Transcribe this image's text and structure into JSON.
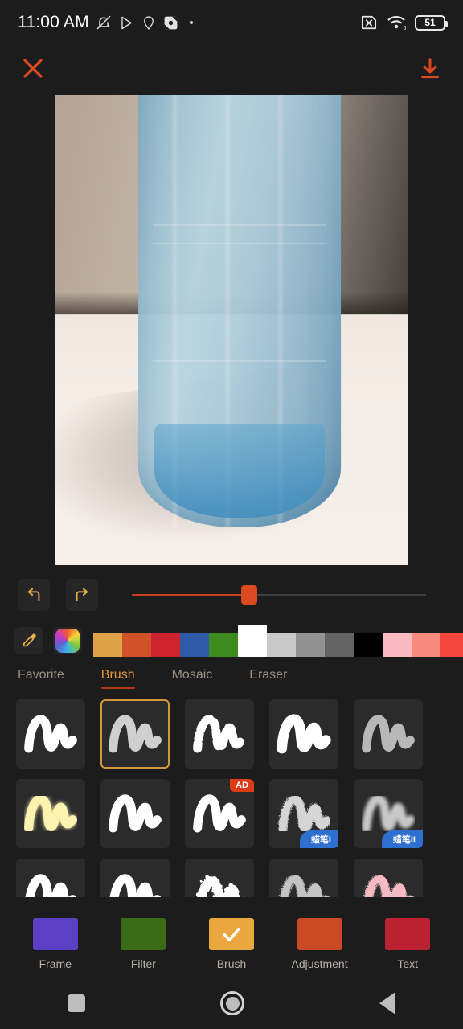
{
  "status_bar": {
    "time": "11:00 AM",
    "battery_level": "51",
    "wifi_generation": "6",
    "left_icons": [
      "silent-mode-icon",
      "play-store-icon",
      "location-pin-icon",
      "google-maps-icon",
      "more-dot-icon"
    ],
    "right_icons": [
      "sim-off-icon",
      "wifi-icon",
      "battery-icon"
    ]
  },
  "top_bar": {
    "close_label": "close-icon",
    "save_label": "download-icon",
    "accent_color": "#dc4a22"
  },
  "photo": {
    "subject": "blue plastic bottle on white table",
    "alt": "Close-up photo of a translucent blue plastic bottle standing on a white table with a beige wall behind it"
  },
  "controls": {
    "undo_label": "undo-icon",
    "redo_label": "redo-icon",
    "slider_value": 40,
    "slider_min": 0,
    "slider_max": 100,
    "slider_fill_color": "#cc3f1e",
    "icon_color": "#e8b24c"
  },
  "palette": {
    "eyedropper_label": "eyedropper-icon",
    "color_wheel_label": "color-wheel-icon",
    "selected_color": "#ffffff",
    "swatches": [
      "#e0a247",
      "#cf5228",
      "#cd2430",
      "#2f5aa8",
      "#3f8a1e",
      "#ffffff",
      "#c9c9c9",
      "#919191",
      "#636363",
      "#000000",
      "#f9b9c0",
      "#f98b7e",
      "#f4483f",
      "#f21030",
      "#bf1a19",
      "#f7e9b4",
      "#f5d95a"
    ]
  },
  "tabs": {
    "items": [
      {
        "label": "Favorite",
        "active": false
      },
      {
        "label": "Brush",
        "active": true
      },
      {
        "label": "Mosaic",
        "active": false
      },
      {
        "label": "Eraser",
        "active": false
      }
    ],
    "active_color": "#e59a3c",
    "underline_color": "#b5381b"
  },
  "brushes": {
    "selected_index": 1,
    "rows": [
      [
        {
          "name": "smooth-marker-brush",
          "style": "solid-white",
          "badge": ""
        },
        {
          "name": "chalk-brush",
          "style": "gray-chalk",
          "badge": ""
        },
        {
          "name": "dotted-brush",
          "style": "dotted-white",
          "badge": ""
        },
        {
          "name": "bold-marker-brush",
          "style": "bold-white",
          "badge": ""
        },
        {
          "name": "soft-gray-brush",
          "style": "soft-gray",
          "badge": ""
        }
      ],
      [
        {
          "name": "neon-glow-brush",
          "style": "neon-yellow",
          "badge": ""
        },
        {
          "name": "highlighter-brush",
          "style": "solid-white-arrow",
          "badge": ""
        },
        {
          "name": "dashed-arrow-brush",
          "style": "dashed-white-arrow",
          "badge": "AD"
        },
        {
          "name": "crayon-one-brush",
          "style": "speckled-gray",
          "badge": "蜡笔I"
        },
        {
          "name": "crayon-two-brush",
          "style": "soft-blur-gray",
          "badge": "蜡笔II"
        }
      ],
      [
        {
          "name": "round-white-brush",
          "style": "solid-white",
          "badge": ""
        },
        {
          "name": "round-white-brush-2",
          "style": "solid-white",
          "badge": ""
        },
        {
          "name": "pixel-brush",
          "style": "pixel-white",
          "badge": ""
        },
        {
          "name": "glitter-gray-brush",
          "style": "glitter-gray",
          "badge": ""
        },
        {
          "name": "glitter-pink-brush",
          "style": "glitter-pink",
          "badge": ""
        }
      ]
    ],
    "selected_border_color": "#d4983c"
  },
  "bottom_toolbar": {
    "items": [
      {
        "label": "Frame",
        "color": "#5b3fc4",
        "active": false
      },
      {
        "label": "Filter",
        "color": "#3a6b16",
        "active": false
      },
      {
        "label": "Brush",
        "color": "#eaa63f",
        "active": true
      },
      {
        "label": "Adjustment",
        "color": "#cb4a26",
        "active": false
      },
      {
        "label": "Text",
        "color": "#bb2333",
        "active": false
      }
    ]
  },
  "nav_bar": {
    "recents_label": "recents-icon",
    "home_label": "home-icon",
    "back_label": "back-icon"
  }
}
